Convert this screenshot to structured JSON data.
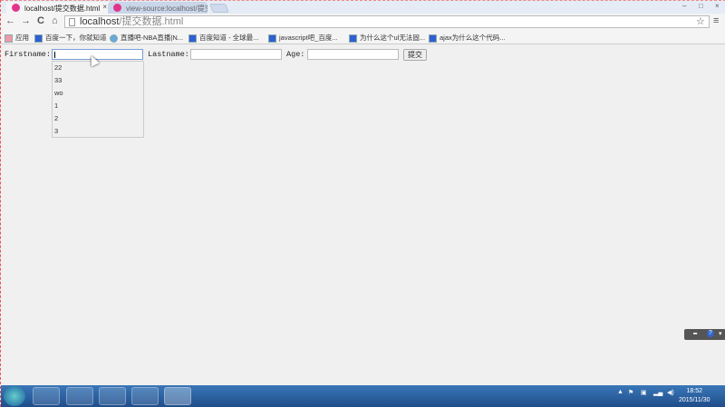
{
  "browser": {
    "tabs": [
      {
        "title": "localhost/提交数据.html",
        "close": "×"
      },
      {
        "title": "view-source:localhost/提交数据.html"
      }
    ],
    "window_controls": [
      "–",
      "□",
      "×"
    ],
    "nav": {
      "back": "←",
      "forward": "→",
      "reload": "C",
      "home": "⌂"
    },
    "address": {
      "host": "localhost",
      "path": "/提交数据.html"
    },
    "star": "☆",
    "menu": "≡",
    "bookmarks": [
      "应用",
      "百度一下，你就知道",
      "直播吧-NBA直播|N...",
      "百度知道 - 全球最...",
      "javascript吧_百度...",
      "为什么这个ul无法固...",
      "ajax为什么这个代码..."
    ]
  },
  "form": {
    "firstname_label": "Firstname:",
    "lastname_label": "Lastname:",
    "age_label": "Age:",
    "firstname_value": "",
    "lastname_value": "",
    "age_value": "",
    "submit_label": "提交",
    "autocomplete": [
      "22",
      "33",
      "wo",
      "1",
      "2",
      "3"
    ]
  },
  "devbar": {
    "help": "?"
  },
  "taskbar": {
    "time": "18:52",
    "date": "2015/11/30"
  }
}
